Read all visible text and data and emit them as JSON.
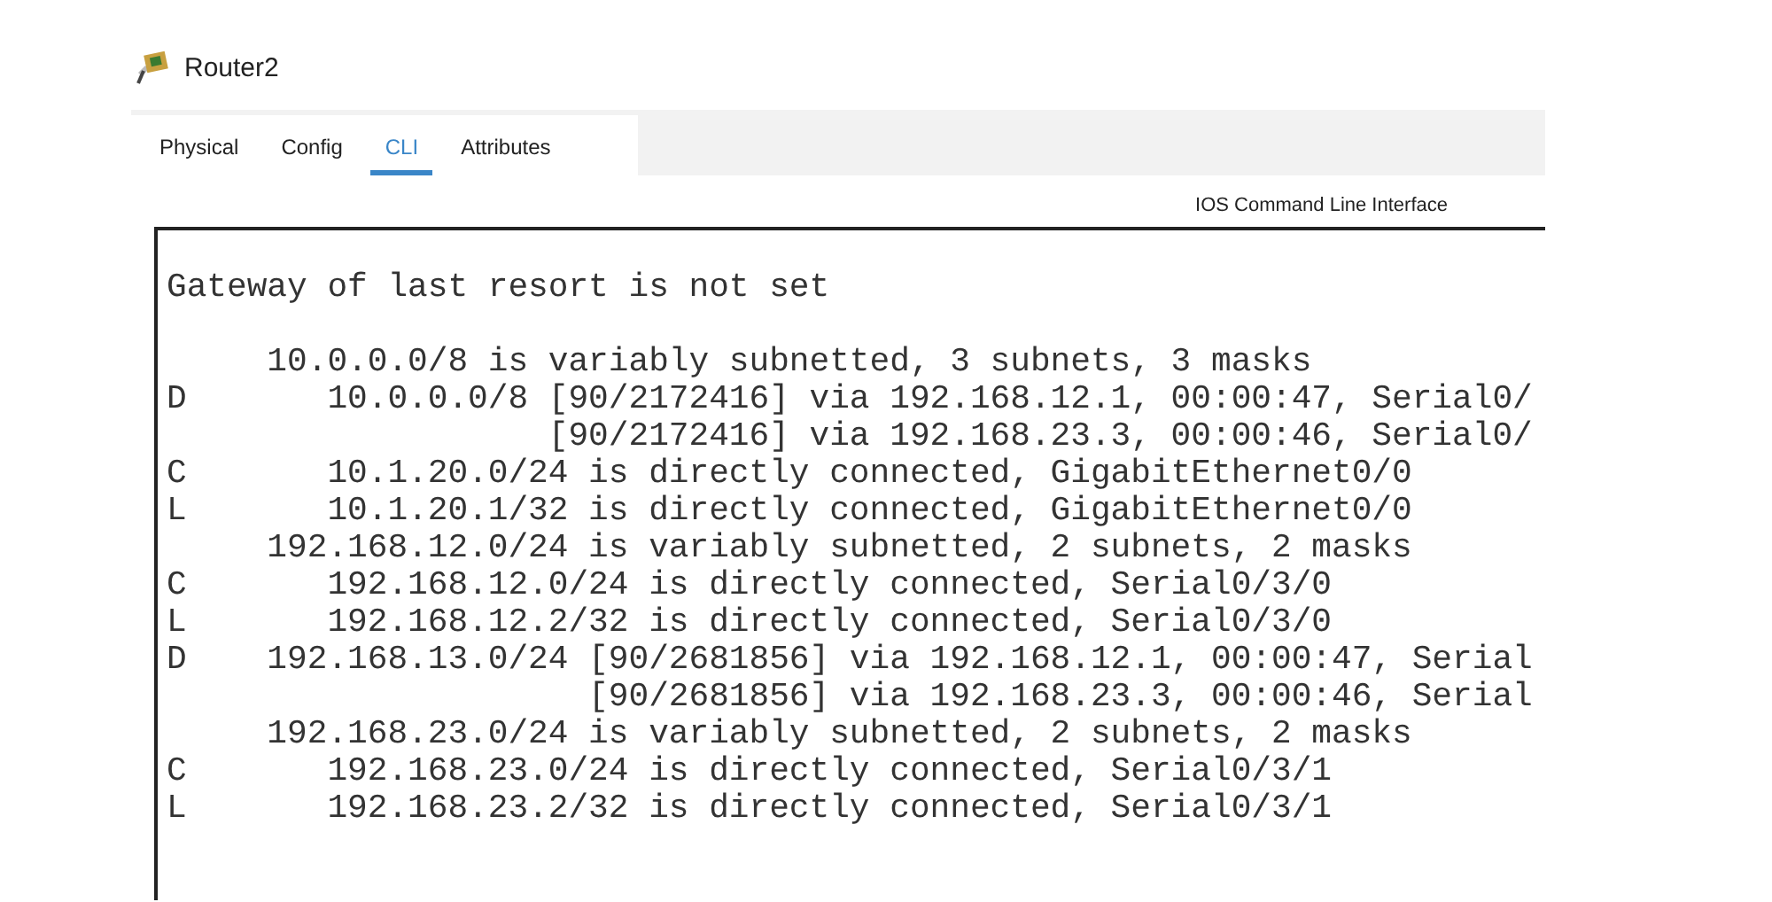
{
  "window": {
    "title": "Router2"
  },
  "tabs": [
    {
      "label": "Physical",
      "selected": false
    },
    {
      "label": "Config",
      "selected": false
    },
    {
      "label": "CLI",
      "selected": true
    },
    {
      "label": "Attributes",
      "selected": false
    }
  ],
  "cli_header": "IOS Command Line Interface",
  "terminal": {
    "blocks": [
      [
        "Gateway of last resort is not set"
      ],
      [
        "     10.0.0.0/8 is variably subnetted, 3 subnets, 3 masks",
        "D       10.0.0.0/8 [90/2172416] via 192.168.12.1, 00:00:47, Serial0/",
        "                   [90/2172416] via 192.168.23.3, 00:00:46, Serial0/",
        "C       10.1.20.0/24 is directly connected, GigabitEthernet0/0",
        "L       10.1.20.1/32 is directly connected, GigabitEthernet0/0",
        "     192.168.12.0/24 is variably subnetted, 2 subnets, 2 masks",
        "C       192.168.12.0/24 is directly connected, Serial0/3/0",
        "L       192.168.12.2/32 is directly connected, Serial0/3/0",
        "D    192.168.13.0/24 [90/2681856] via 192.168.12.1, 00:00:47, Serial",
        "                     [90/2681856] via 192.168.23.3, 00:00:46, Serial",
        "     192.168.23.0/24 is variably subnetted, 2 subnets, 2 masks",
        "C       192.168.23.0/24 is directly connected, Serial0/3/1",
        "L       192.168.23.2/32 is directly connected, Serial0/3/1"
      ]
    ]
  }
}
